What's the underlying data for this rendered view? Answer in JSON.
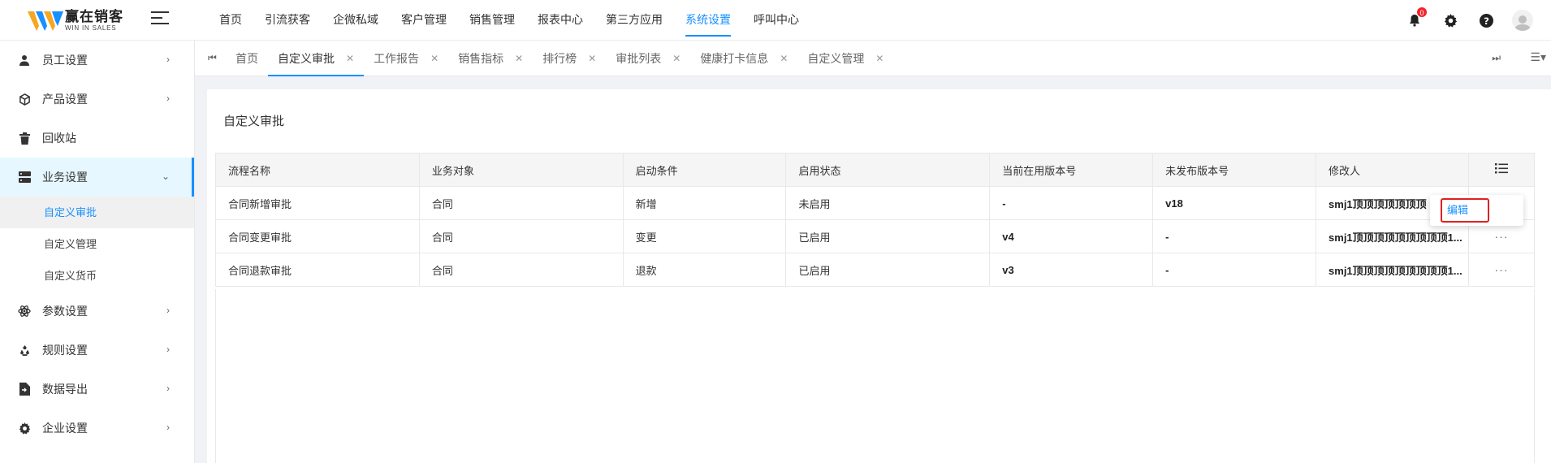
{
  "brand": {
    "name_cn": "赢在销客",
    "name_en": "WIN IN SALES"
  },
  "colors": {
    "primary": "#1890ff",
    "badge": "#f5222d",
    "highlight_border": "#e02020"
  },
  "topnav": [
    {
      "label": "首页"
    },
    {
      "label": "引流获客"
    },
    {
      "label": "企微私域"
    },
    {
      "label": "客户管理"
    },
    {
      "label": "销售管理"
    },
    {
      "label": "报表中心"
    },
    {
      "label": "第三方应用"
    },
    {
      "label": "系统设置",
      "active": true
    },
    {
      "label": "呼叫中心"
    }
  ],
  "header": {
    "notification_count": "0"
  },
  "icons": {
    "theme": "moon-icon",
    "notifications": "bell-icon",
    "settings": "gear-icon",
    "help": "question-icon",
    "user": "user-avatar-icon"
  },
  "sidebar": {
    "items": [
      {
        "label": "员工设置",
        "icon": "user-icon"
      },
      {
        "label": "产品设置",
        "icon": "cube-icon"
      },
      {
        "label": "回收站",
        "icon": "trash-icon"
      },
      {
        "label": "业务设置",
        "icon": "server-icon",
        "open": true,
        "children": [
          {
            "label": "自定义审批",
            "active": true
          },
          {
            "label": "自定义管理"
          },
          {
            "label": "自定义货币"
          }
        ]
      },
      {
        "label": "参数设置",
        "icon": "atom-icon"
      },
      {
        "label": "规则设置",
        "icon": "recycle-icon"
      },
      {
        "label": "数据导出",
        "icon": "file-export-icon"
      },
      {
        "label": "企业设置",
        "icon": "gear-icon"
      }
    ]
  },
  "tabs": [
    {
      "label": "首页",
      "closable": false
    },
    {
      "label": "自定义审批",
      "closable": true,
      "active": true
    },
    {
      "label": "工作报告",
      "closable": true
    },
    {
      "label": "销售指标",
      "closable": true
    },
    {
      "label": "排行榜",
      "closable": true
    },
    {
      "label": "审批列表",
      "closable": true
    },
    {
      "label": "健康打卡信息",
      "closable": true
    },
    {
      "label": "自定义管理",
      "closable": true
    }
  ],
  "page": {
    "title": "自定义审批"
  },
  "table": {
    "columns": [
      "流程名称",
      "业务对象",
      "启动条件",
      "启用状态",
      "当前在用版本号",
      "未发布版本号",
      "修改人"
    ],
    "rows": [
      [
        "合同新增审批",
        "合同",
        "新增",
        "未启用",
        "-",
        "v18",
        "smj1顶顶顶顶顶顶顶"
      ],
      [
        "合同变更审批",
        "合同",
        "变更",
        "已启用",
        "v4",
        "-",
        "smj1顶顶顶顶顶顶顶顶顶1..."
      ],
      [
        "合同退款审批",
        "合同",
        "退款",
        "已启用",
        "v3",
        "-",
        "smj1顶顶顶顶顶顶顶顶顶1..."
      ]
    ],
    "row_action": "···"
  },
  "dropdown": {
    "edit_label": "编辑"
  }
}
